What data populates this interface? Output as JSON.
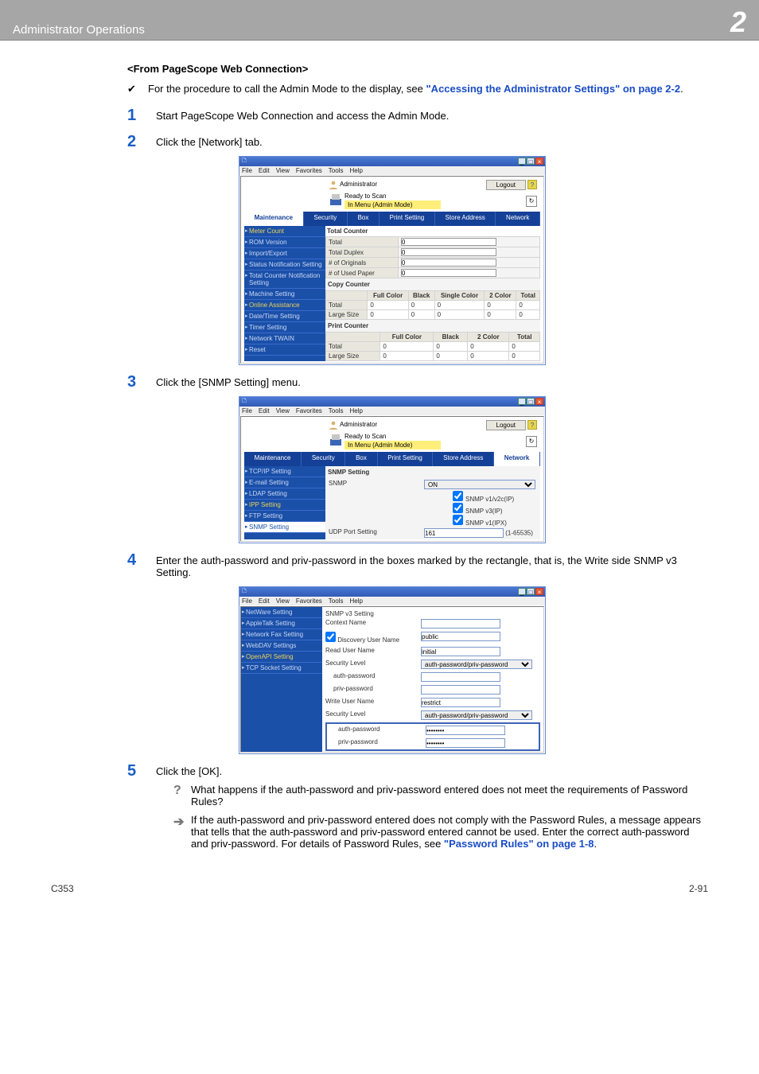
{
  "header": {
    "title": "Administrator Operations",
    "chapter": "2"
  },
  "section_heading": "<From PageScope Web Connection>",
  "intro": {
    "prefix": "For the procedure to call the Admin Mode to the display, see ",
    "link1": "\"Accessing the Administrator Settings\" on page 2-2",
    "suffix": "."
  },
  "steps": {
    "s1": {
      "num": "1",
      "text": "Start PageScope Web Connection and access the Admin Mode."
    },
    "s2": {
      "num": "2",
      "text": "Click the [Network] tab."
    },
    "s3": {
      "num": "3",
      "text": "Click the [SNMP Setting] menu."
    },
    "s4": {
      "num": "4",
      "text": "Enter the auth-password and priv-password in the boxes marked by the rectangle, that is, the Write side SNMP v3 Setting."
    },
    "s5": {
      "num": "5",
      "text": "Click the [OK].",
      "q": "What happens if the auth-password and priv-password entered does not meet the requirements of Password Rules?",
      "a_prefix": "If the auth-password and priv-password entered does not comply with the Password Rules, a message appears that tells that the auth-password and priv-password entered cannot be used. Enter the correct auth-password and priv-password. For details of Password Rules, see ",
      "a_link": "\"Password Rules\" on page 1-8",
      "a_suffix": "."
    }
  },
  "win_common": {
    "menus": {
      "file": "File",
      "edit": "Edit",
      "view": "View",
      "favorites": "Favorites",
      "tools": "Tools",
      "help": "Help"
    },
    "admin_label": "Administrator",
    "logout_label": "Logout",
    "ready_label": "Ready to Scan",
    "menu_mode": "In Menu (Admin Mode)"
  },
  "tabs": {
    "maintenance": "Maintenance",
    "security": "Security",
    "box": "Box",
    "print_setting": "Print Setting",
    "store_address": "Store Address",
    "network": "Network"
  },
  "screenshot_a": {
    "side": {
      "meter": "Meter Count",
      "rom": "ROM Version",
      "impexp": "Import/Export",
      "status_notif": "Status Notification Setting",
      "tcn": "Total Counter Notification Setting",
      "machine": "Machine Setting",
      "online": "Online Assistance",
      "datetime": "Date/Time Setting",
      "timer": "Timer Setting",
      "twain": "Network TWAIN",
      "reset": "Reset"
    },
    "total_counter_caption": "Total Counter",
    "tc_rows": {
      "total": "Total",
      "duplex": "Total Duplex",
      "originals": "# of Originals",
      "used_paper": "# of Used Paper"
    },
    "tc_vals": {
      "total": "0",
      "duplex": "0",
      "originals": "0",
      "used_paper": "0"
    },
    "copy_caption": "Copy Counter",
    "print_caption": "Print Counter",
    "cols": {
      "fullcolor": "Full Color",
      "black": "Black",
      "single": "Single Color",
      "two": "2 Color",
      "total_col": "Total"
    },
    "rows": {
      "total": "Total",
      "large": "Large Size"
    },
    "zero": "0"
  },
  "screenshot_b": {
    "side": {
      "tcpip": "TCP/IP Setting",
      "email": "E-mail Setting",
      "ldap": "LDAP Setting",
      "ipp": "IPP Setting",
      "ftp": "FTP Setting",
      "snmp": "SNMP Setting"
    },
    "title": "SNMP Setting",
    "snmp_label": "SNMP",
    "snmp_value": "ON",
    "chk1": "SNMP v1/v2c(IP)",
    "chk2": "SNMP v3(IP)",
    "chk3": "SNMP v1(IPX)",
    "udp_label": "UDP Port Setting",
    "udp_value": "161",
    "udp_range": "(1-65535)"
  },
  "screenshot_c": {
    "side": {
      "netware": "NetWare Setting",
      "appletalk": "AppleTalk Setting",
      "netfax": "Network Fax Setting",
      "webdav": "WebDAV Settings",
      "openapi": "OpenAPI Setting",
      "tcpsocket": "TCP Socket Setting"
    },
    "title": "SNMP v3 Setting",
    "labels": {
      "context": "Context Name",
      "discovery": "Discovery User Name",
      "read_user": "Read User Name",
      "seclevel": "Security Level",
      "authpw": "auth-password",
      "privpw": "priv-password",
      "write_user": "Write User Name"
    },
    "values": {
      "discovery": "public",
      "read_user": "initial",
      "seclevel": "auth-password/priv-password",
      "write_user": "restrict",
      "write_auth": "••••••••",
      "write_priv": "••••••••"
    }
  },
  "footer": {
    "left": "C353",
    "right": "2-91"
  }
}
